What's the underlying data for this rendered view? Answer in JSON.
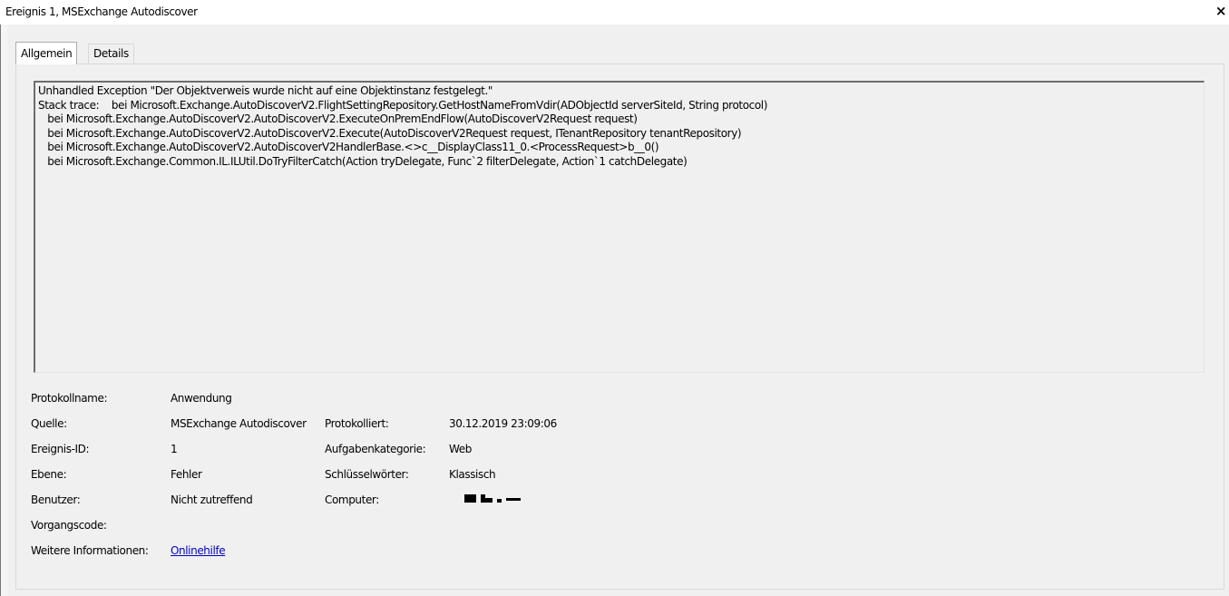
{
  "window": {
    "title": "Ereignis 1, MSExchange Autodiscover",
    "close_glyph": "×"
  },
  "tabs": [
    {
      "label": "Allgemein",
      "active": true
    },
    {
      "label": "Details",
      "active": false
    }
  ],
  "description": {
    "lines": [
      "Unhandled Exception \"Der Objektverweis wurde nicht auf eine Objektinstanz festgelegt.\"",
      "Stack trace:    bei Microsoft.Exchange.AutoDiscoverV2.FlightSettingRepository.GetHostNameFromVdir(ADObjectId serverSiteId, String protocol)",
      "   bei Microsoft.Exchange.AutoDiscoverV2.AutoDiscoverV2.ExecuteOnPremEndFlow(AutoDiscoverV2Request request)",
      "   bei Microsoft.Exchange.AutoDiscoverV2.AutoDiscoverV2.Execute(AutoDiscoverV2Request request, ITenantRepository tenantRepository)",
      "   bei Microsoft.Exchange.AutoDiscoverV2.AutoDiscoverV2HandlerBase.<>c__DisplayClass11_0.<ProcessRequest>b__0()",
      "   bei Microsoft.Exchange.Common.IL.ILUtil.DoTryFilterCatch(Action tryDelegate, Func`2 filterDelegate, Action`1 catchDelegate)"
    ]
  },
  "details": {
    "protokollname_label": "Protokollname:",
    "protokollname_value": "Anwendung",
    "quelle_label": "Quelle:",
    "quelle_value": "MSExchange Autodiscover",
    "protokolliert_label": "Protokolliert:",
    "protokolliert_value": "30.12.2019 23:09:06",
    "ereignis_id_label": "Ereignis-ID:",
    "ereignis_id_value": "1",
    "aufgabenkategorie_label": "Aufgabenkategorie:",
    "aufgabenkategorie_value": "Web",
    "ebene_label": "Ebene:",
    "ebene_value": "Fehler",
    "schluesselwoerter_label": "Schlüsselwörter:",
    "schluesselwoerter_value": "Klassisch",
    "benutzer_label": "Benutzer:",
    "benutzer_value": "Nicht zutreffend",
    "computer_label": "Computer:",
    "computer_value": "redacted",
    "vorgangscode_label": "Vorgangscode:",
    "vorgangscode_value": "",
    "weitere_label": "Weitere Informationen:",
    "weitere_link": "Onlinehilfe"
  },
  "colors": {
    "window_bg": "#f0f0f0",
    "link": "#0000cc",
    "redaction": "#000000"
  }
}
